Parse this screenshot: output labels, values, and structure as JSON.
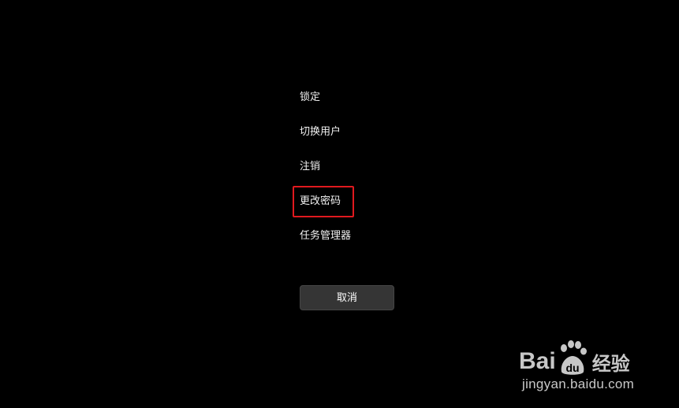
{
  "menu": {
    "items": [
      {
        "label": "锁定"
      },
      {
        "label": "切换用户"
      },
      {
        "label": "注销"
      },
      {
        "label": "更改密码",
        "highlighted": true
      },
      {
        "label": "任务管理器"
      }
    ]
  },
  "cancel_button": {
    "label": "取消"
  },
  "watermark": {
    "brand_left": "Bai",
    "brand_mid": "du",
    "brand_right": "经验",
    "url": "jingyan.baidu.com"
  },
  "colors": {
    "background": "#000000",
    "highlight_border": "#e0191e",
    "button_bg": "#353535"
  }
}
